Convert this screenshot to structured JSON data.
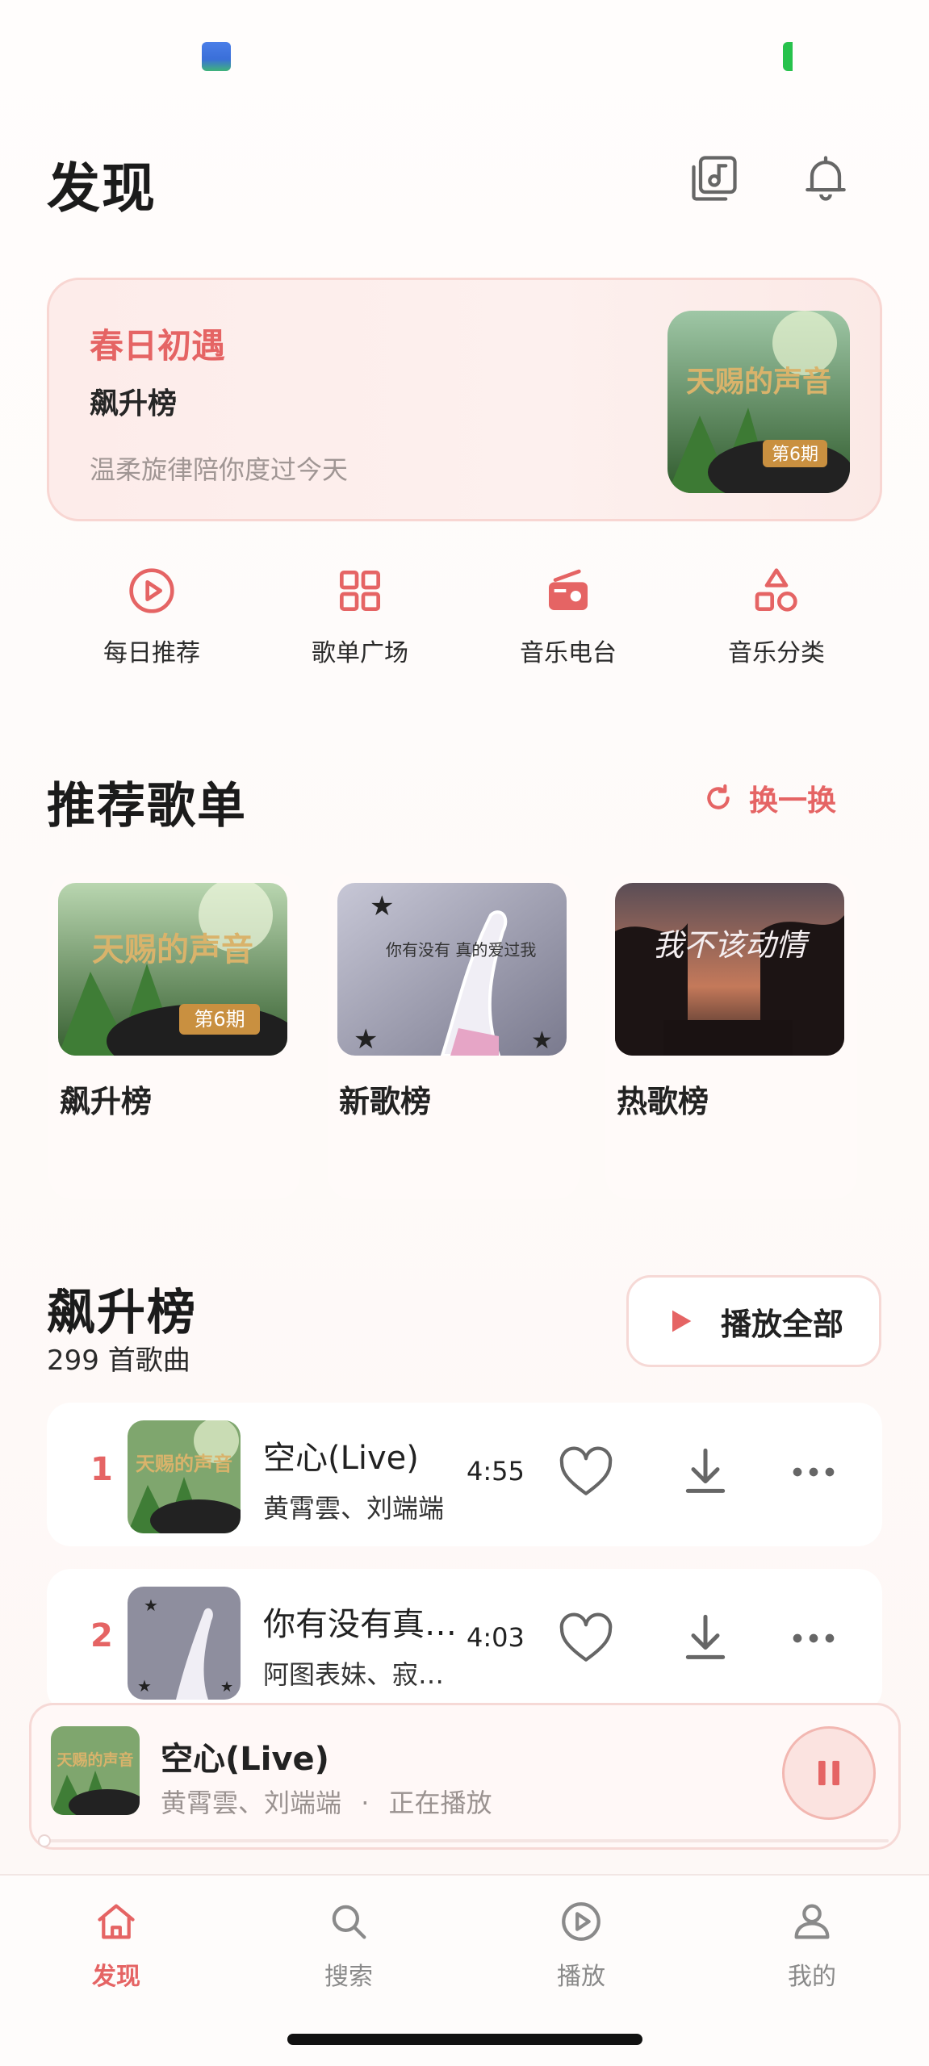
{
  "header": {
    "title": "发现",
    "icons": [
      "music-library-icon",
      "bell-icon"
    ]
  },
  "featured": {
    "title": "春日初遇",
    "subtitle": "飙升榜",
    "description": "温柔旋律陪你度过今天",
    "colors": {
      "accent": "#e56464"
    }
  },
  "quick_nav": [
    {
      "label": "每日推荐",
      "icon": "play-circle-icon"
    },
    {
      "label": "歌单广场",
      "icon": "grid-icon"
    },
    {
      "label": "音乐电台",
      "icon": "radio-icon"
    },
    {
      "label": "音乐分类",
      "icon": "shapes-icon"
    }
  ],
  "recommend": {
    "title": "推荐歌单",
    "refresh_label": "换一换",
    "playlists": [
      {
        "name": "飙升榜",
        "cover_text": "天赐的声音",
        "cover_badge": "第6期"
      },
      {
        "name": "新歌榜",
        "cover_text": "你有没有 真的爱过我"
      },
      {
        "name": "热歌榜",
        "cover_text": "我不该动情"
      }
    ]
  },
  "chart": {
    "title": "飙升榜",
    "count": "299 首歌曲",
    "play_all_label": "播放全部",
    "songs": [
      {
        "rank": "1",
        "title": "空心(Live)",
        "artist": "黄霄雲、刘端端",
        "duration": "4:55"
      },
      {
        "rank": "2",
        "title": "你有没有真…",
        "artist": "阿图表妹、寂…",
        "duration": "4:03"
      }
    ]
  },
  "mini_player": {
    "title": "空心(Live)",
    "artist": "黄霄雲、刘端端",
    "separator": "·",
    "status": "正在播放",
    "progress": 0.01
  },
  "bottom_nav": [
    {
      "label": "发现",
      "icon": "home-icon",
      "active": true
    },
    {
      "label": "搜索",
      "icon": "search-icon",
      "active": false
    },
    {
      "label": "播放",
      "icon": "play-circle-icon",
      "active": false
    },
    {
      "label": "我的",
      "icon": "user-icon",
      "active": false
    }
  ],
  "colors": {
    "accent": "#e56464",
    "text": "#1b1b1b",
    "muted": "#8a8a8a"
  }
}
